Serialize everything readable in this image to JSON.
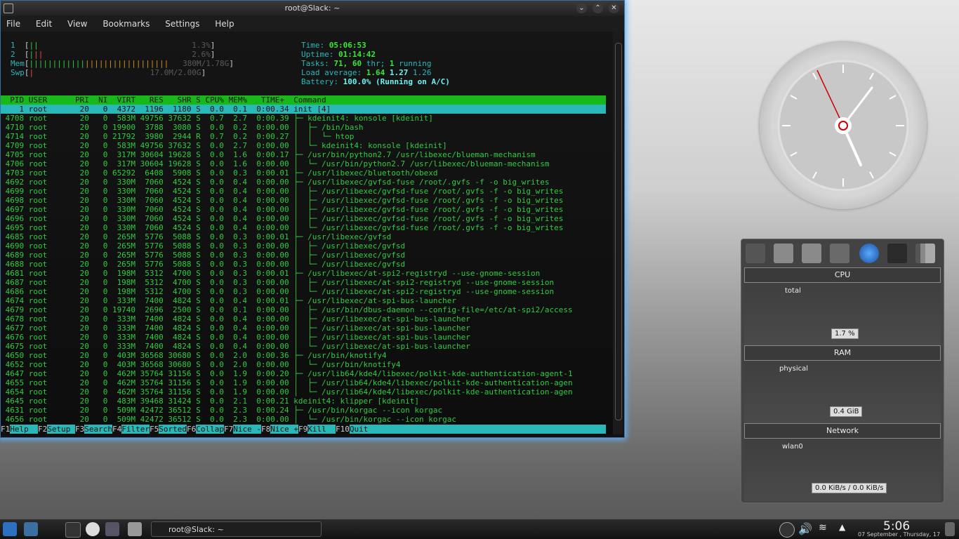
{
  "window": {
    "title": "root@Slack: ~"
  },
  "menu": [
    "File",
    "Edit",
    "View",
    "Bookmarks",
    "Settings",
    "Help"
  ],
  "meters": {
    "cpu1": {
      "label": "1",
      "percent": "1.3%"
    },
    "cpu2": {
      "label": "2",
      "percent": "2.6%"
    },
    "mem": {
      "label": "Mem",
      "value": "380M/1.78G"
    },
    "swp": {
      "label": "Swp",
      "value": "17.0M/2.00G"
    }
  },
  "stats": {
    "time_label": "Time:",
    "time": "05:06:53",
    "uptime_label": "Uptime:",
    "uptime": "01:14:42",
    "tasks_label": "Tasks:",
    "tasks": "71,",
    "thr": "60",
    "thr_label": "thr;",
    "running": "1",
    "running_label": "running",
    "load_label": "Load average:",
    "load1": "1.64",
    "load5": "1.27",
    "load15": "1.26",
    "battery_label": "Battery:",
    "battery": "100.0% (Running on A/C)"
  },
  "table_header": "  PID USER      PRI  NI  VIRT   RES   SHR S CPU% MEM%   TIME+  Command",
  "processes": [
    "    1 root       20   0  4372  1196  1180 S  0.0  0.1  0:00.34 init [4]",
    " 4708 root       20   0  583M 49756 37632 S  0.7  2.7  0:00.39 ├─ kdeinit4: konsole [kdeinit]",
    " 4710 root       20   0 19900  3788  3080 S  0.0  0.2  0:00.00 │  ├─ /bin/bash",
    " 4714 root       20   0 21792  3980  2944 R  0.7  0.2  0:00.27 │  │  └─ htop",
    " 4709 root       20   0  583M 49756 37632 S  0.0  2.7  0:00.00 │  └─ kdeinit4: konsole [kdeinit]",
    " 4705 root       20   0  317M 30604 19628 S  0.0  1.6  0:00.17 ├─ /usr/bin/python2.7 /usr/libexec/blueman-mechanism",
    " 4706 root       20   0  317M 30604 19628 S  0.0  1.6  0:00.00 │  └─ /usr/bin/python2.7 /usr/libexec/blueman-mechanism",
    " 4703 root       20   0 65292  6408  5908 S  0.0  0.3  0:00.01 ├─ /usr/libexec/bluetooth/obexd",
    " 4692 root       20   0  330M  7060  4524 S  0.0  0.4  0:00.00 ├─ /usr/libexec/gvfsd-fuse /root/.gvfs -f -o big_writes",
    " 4699 root       20   0  330M  7060  4524 S  0.0  0.4  0:00.00 │  ├─ /usr/libexec/gvfsd-fuse /root/.gvfs -f -o big_writes",
    " 4698 root       20   0  330M  7060  4524 S  0.0  0.4  0:00.00 │  ├─ /usr/libexec/gvfsd-fuse /root/.gvfs -f -o big_writes",
    " 4697 root       20   0  330M  7060  4524 S  0.0  0.4  0:00.00 │  ├─ /usr/libexec/gvfsd-fuse /root/.gvfs -f -o big_writes",
    " 4696 root       20   0  330M  7060  4524 S  0.0  0.4  0:00.00 │  ├─ /usr/libexec/gvfsd-fuse /root/.gvfs -f -o big_writes",
    " 4695 root       20   0  330M  7060  4524 S  0.0  0.4  0:00.00 │  └─ /usr/libexec/gvfsd-fuse /root/.gvfs -f -o big_writes",
    " 4685 root       20   0  265M  5776  5088 S  0.0  0.3  0:00.01 ├─ /usr/libexec/gvfsd",
    " 4690 root       20   0  265M  5776  5088 S  0.0  0.3  0:00.00 │  ├─ /usr/libexec/gvfsd",
    " 4689 root       20   0  265M  5776  5088 S  0.0  0.3  0:00.00 │  ├─ /usr/libexec/gvfsd",
    " 4688 root       20   0  265M  5776  5088 S  0.0  0.3  0:00.00 │  └─ /usr/libexec/gvfsd",
    " 4681 root       20   0  198M  5312  4700 S  0.0  0.3  0:00.01 ├─ /usr/libexec/at-spi2-registryd --use-gnome-session",
    " 4687 root       20   0  198M  5312  4700 S  0.0  0.3  0:00.00 │  ├─ /usr/libexec/at-spi2-registryd --use-gnome-session",
    " 4686 root       20   0  198M  5312  4700 S  0.0  0.3  0:00.00 │  └─ /usr/libexec/at-spi2-registryd --use-gnome-session",
    " 4674 root       20   0  333M  7400  4824 S  0.0  0.4  0:00.01 ├─ /usr/libexec/at-spi-bus-launcher",
    " 4679 root       20   0 19740  2696  2500 S  0.0  0.1  0:00.00 │  ├─ /usr/bin/dbus-daemon --config-file=/etc/at-spi2/access",
    " 4678 root       20   0  333M  7400  4824 S  0.0  0.4  0:00.00 │  ├─ /usr/libexec/at-spi-bus-launcher",
    " 4677 root       20   0  333M  7400  4824 S  0.0  0.4  0:00.00 │  ├─ /usr/libexec/at-spi-bus-launcher",
    " 4676 root       20   0  333M  7400  4824 S  0.0  0.4  0:00.00 │  ├─ /usr/libexec/at-spi-bus-launcher",
    " 4675 root       20   0  333M  7400  4824 S  0.0  0.4  0:00.00 │  └─ /usr/libexec/at-spi-bus-launcher",
    " 4650 root       20   0  403M 36568 30680 S  0.0  2.0  0:00.36 ├─ /usr/bin/knotify4",
    " 4652 root       20   0  403M 36568 30680 S  0.0  2.0  0:00.00 │  └─ /usr/bin/knotify4",
    " 4647 root       20   0  462M 35764 31156 S  0.0  1.9  0:00.20 ├─ /usr/lib64/kde4/libexec/polkit-kde-authentication-agent-1",
    " 4655 root       20   0  462M 35764 31156 S  0.0  1.9  0:00.00 │  ├─ /usr/lib64/kde4/libexec/polkit-kde-authentication-agen",
    " 4654 root       20   0  462M 35764 31156 S  0.0  1.9  0:00.00 │  └─ /usr/lib64/kde4/libexec/polkit-kde-authentication-agen",
    " 4645 root       20   0  483M 39468 31424 S  0.0  2.1  0:00.21 kdeinit4: klipper [kdeinit]",
    " 4631 root       20   0  509M 42472 36512 S  0.0  2.3  0:00.24 ├─ /usr/bin/korgac --icon korgac",
    " 4656 root       20   0  509M 42472 36512 S  0.0  2.3  0:00.00 │  └─ /usr/bin/korgac --icon korgac"
  ],
  "fkeys": [
    {
      "k": "F1",
      "v": "Help  "
    },
    {
      "k": "F2",
      "v": "Setup "
    },
    {
      "k": "F3",
      "v": "Search"
    },
    {
      "k": "F4",
      "v": "Filter"
    },
    {
      "k": "F5",
      "v": "Sorted"
    },
    {
      "k": "F6",
      "v": "Collap"
    },
    {
      "k": "F7",
      "v": "Nice -"
    },
    {
      "k": "F8",
      "v": "Nice +"
    },
    {
      "k": "F9",
      "v": "Kill  "
    },
    {
      "k": "F10",
      "v": "Quit  "
    }
  ],
  "sysmon": {
    "cpu": {
      "header": "CPU",
      "label": "total",
      "value": "1.7 %"
    },
    "ram": {
      "header": "RAM",
      "label": "physical",
      "value": "0.4 GiB"
    },
    "net": {
      "header": "Network",
      "label": "wlan0",
      "value": "0.0 KiB/s / 0.0 KiB/s"
    }
  },
  "taskbar": {
    "task": "root@Slack: ~",
    "time": "5:06",
    "date": "07 September , Thursday, 17"
  },
  "colors": {
    "accent": "#2ab7b7",
    "green": "#18b818",
    "glow": "#5fb6ff"
  }
}
